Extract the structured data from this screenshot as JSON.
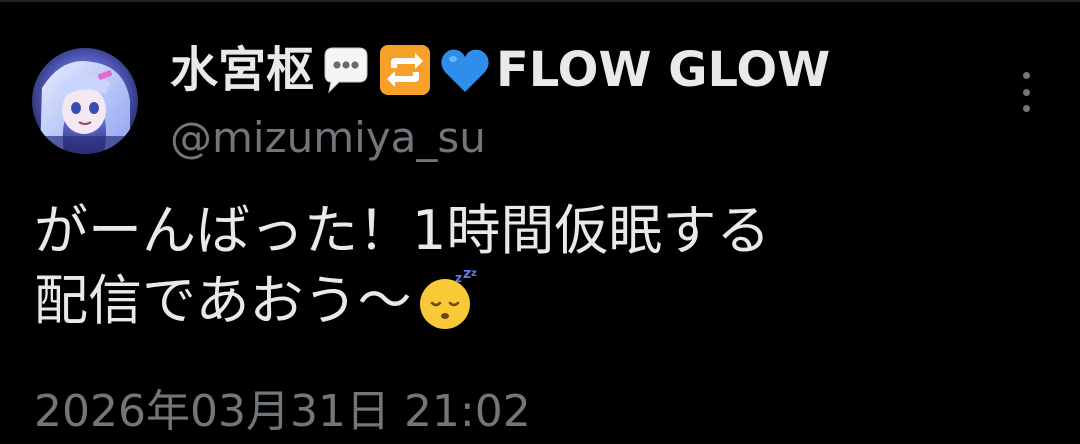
{
  "tweet": {
    "display_name": "水宮枢",
    "display_name_suffix": "FLOW GLOW",
    "name_emojis": [
      "speech-balloon-icon",
      "repeat-icon",
      "blue-heart-icon"
    ],
    "handle": "@mizumiya_su",
    "text_line_1": "がーんばった！1時間仮眠する",
    "text_line_2": "配信であおう〜",
    "text_emoji": "sleeping-face-icon",
    "timestamp": "2026年03月31日 21:02"
  },
  "colors": {
    "background": "#000000",
    "primary_text": "#e7e9ea",
    "secondary_text": "#71767b"
  }
}
